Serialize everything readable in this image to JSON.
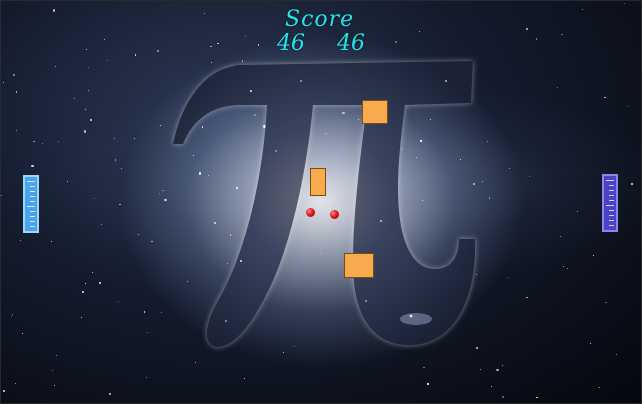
{
  "scoreboard": {
    "label": "Score",
    "left_score": "46",
    "right_score": "46"
  },
  "colors": {
    "score_text": "#22e3ee",
    "left_paddle": "#4aa4ea",
    "right_paddle": "#4b44c2",
    "block": "#f7aa4e",
    "ball": "#e11b1b"
  },
  "background": {
    "symbol": "π",
    "icon": "pi-galaxy-background"
  },
  "objects": {
    "blocks": 3,
    "balls": 2,
    "paddles": 2
  }
}
